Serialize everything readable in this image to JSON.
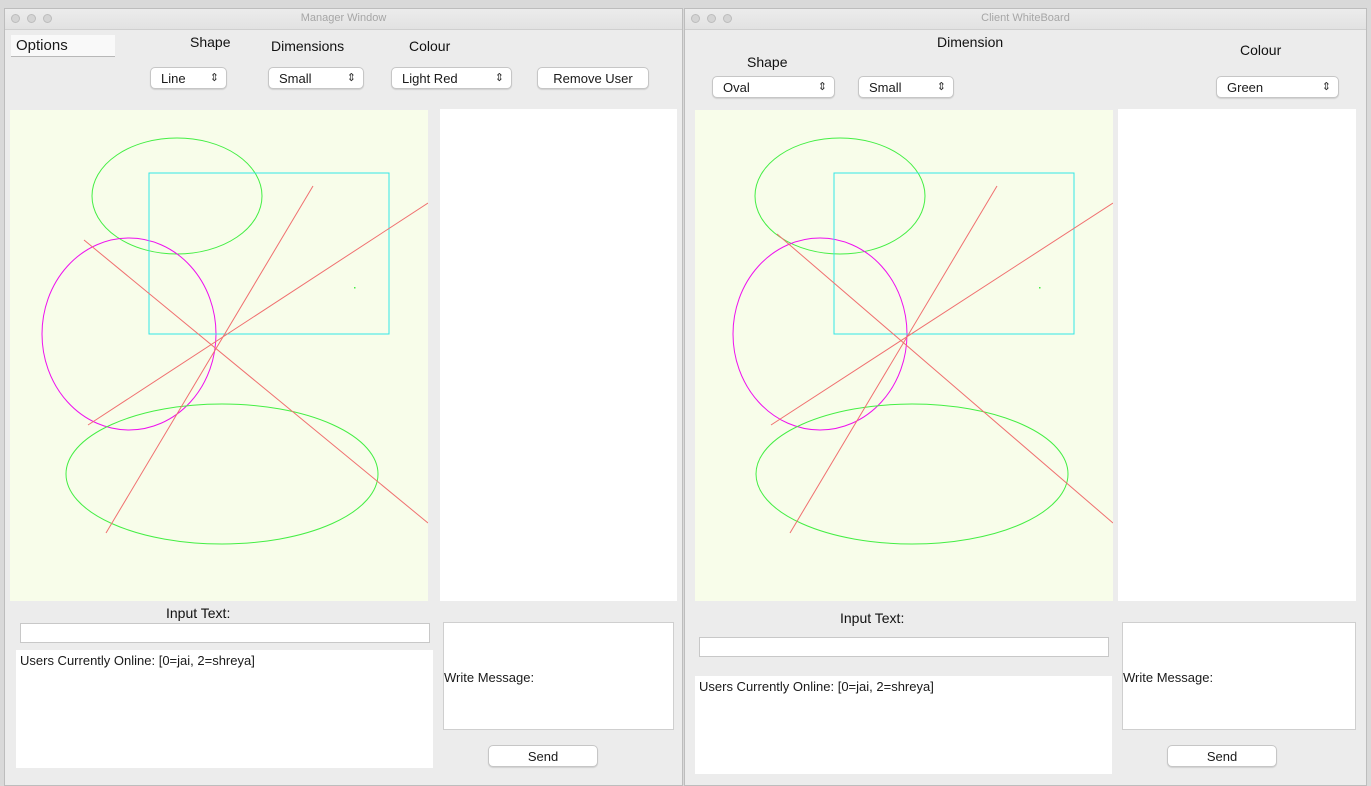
{
  "manager": {
    "title": "Manager Window",
    "options_label": "Options",
    "shape_label": "Shape",
    "dimensions_label": "Dimensions",
    "colour_label": "Colour",
    "shape_value": "Line",
    "dimension_value": "Small",
    "colour_value": "Light Red",
    "remove_user_label": "Remove User",
    "input_text_label": "Input Text:",
    "users_online": "Users Currently Online: [0=jai, 2=shreya]",
    "write_message_label": "Write Message:",
    "send_label": "Send"
  },
  "client": {
    "title": "Client WhiteBoard",
    "shape_label": "Shape",
    "dimension_label": "Dimension",
    "colour_label": "Colour",
    "shape_value": "Oval",
    "dimension_value": "Small",
    "colour_value": "Green",
    "input_text_label": "Input Text:",
    "users_online": "Users Currently Online: [0=jai, 2=shreya]",
    "write_message_label": "Write Message:",
    "send_label": "Send"
  },
  "colors": {
    "canvas_bg": "#f8fdea",
    "green": "#44ee44",
    "magenta": "#ee11ee",
    "cyan": "#33e6e6",
    "light_red": "#f07070"
  },
  "icons": {
    "select_chevron": "chevron-updown-icon",
    "window_controls": "traffic-light-dot"
  }
}
